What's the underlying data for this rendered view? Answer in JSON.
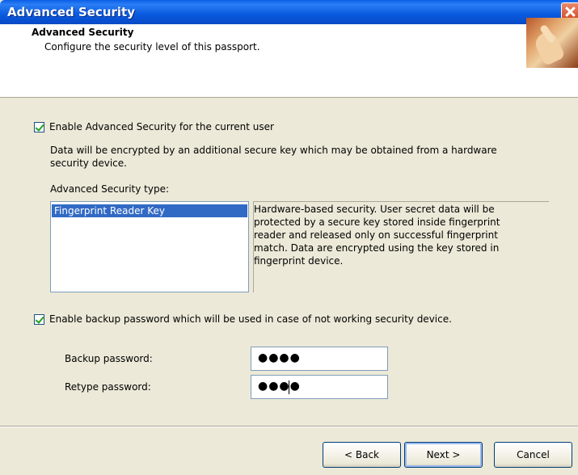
{
  "window": {
    "title": "Advanced Security"
  },
  "header": {
    "title": "Advanced Security",
    "subtitle": "Configure the security level of this passport.",
    "image_icon": "hand-fingerprint-icon"
  },
  "enable_advanced": {
    "label": "Enable Advanced Security for the current user",
    "checked": true
  },
  "description": {
    "line1": "Data will be encrypted by an additional secure key which may be obtained from a hardware",
    "line2": "security device."
  },
  "security_type": {
    "label": "Advanced Security type:",
    "items": [
      "Fingerprint Reader Key"
    ],
    "selected_index": 0,
    "details": "Hardware-based security. User secret data will be\nprotected by a secure key stored inside fingerprint\nreader and released only on successful fingerprint\nmatch. Data are encrypted using the key stored in\nfingerprint device."
  },
  "backup": {
    "label": "Enable backup password which will be used in case of not working security device.",
    "checked": true,
    "password_label": "Backup password:",
    "password_value": "●●●●",
    "retype_label": "Retype password:",
    "retype_value": "●●●●"
  },
  "buttons": {
    "back": "< Back",
    "next": "Next >",
    "cancel": "Cancel"
  },
  "colors": {
    "titlebar": "#0a5ee6",
    "selection": "#316ac5",
    "dialog_bg": "#ece9d8"
  }
}
